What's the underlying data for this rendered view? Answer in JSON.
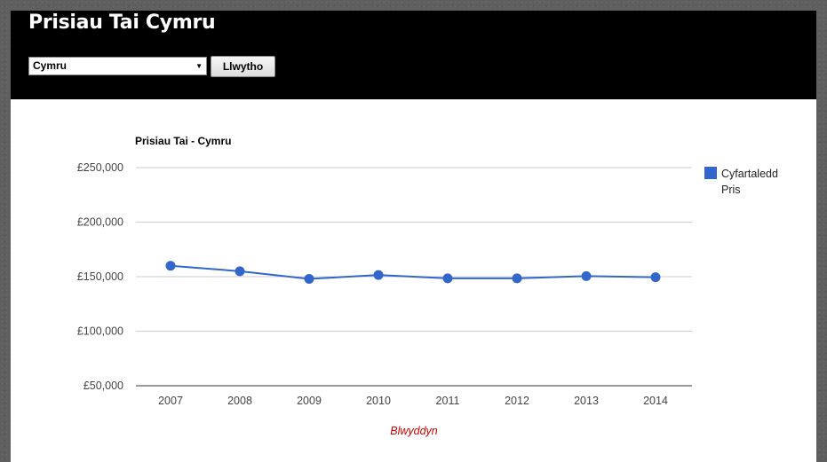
{
  "header": {
    "title": "Prisiau Tai Cymru",
    "region_select": {
      "selected": "Cymru"
    },
    "load_button": "Llwytho"
  },
  "colors": {
    "series": "#3366cc",
    "x_title": "#cc0000",
    "header_bg": "#000000"
  },
  "chart_data": {
    "type": "line",
    "title": "Prisiau Tai - Cymru",
    "xlabel": "Blwyddyn",
    "ylabel": "",
    "x": [
      "2007",
      "2008",
      "2009",
      "2010",
      "2011",
      "2012",
      "2013",
      "2014"
    ],
    "series": [
      {
        "name": "Cyfartaledd Pris",
        "values": [
          160000,
          155000,
          148000,
          151500,
          148500,
          148500,
          150500,
          149500
        ]
      }
    ],
    "ylim": [
      50000,
      250000
    ],
    "yticks": [
      250000,
      200000,
      150000,
      100000,
      50000
    ],
    "ytick_labels": [
      "£250,000",
      "£200,000",
      "£150,000",
      "£100,000",
      "£50,000"
    ],
    "legend": {
      "position": "right",
      "lines": [
        "Cyfartaledd",
        "Pris"
      ]
    },
    "grid": true
  }
}
